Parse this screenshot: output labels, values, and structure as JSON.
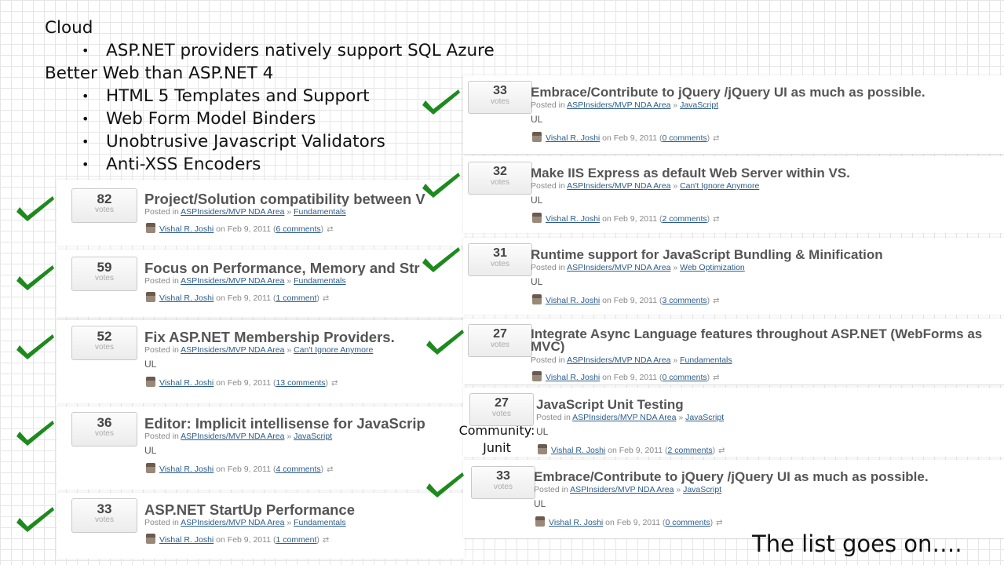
{
  "slide": {
    "heading1": "Cloud",
    "bullets1": [
      "ASP.NET providers natively support SQL Azure"
    ],
    "heading2": "Better Web than ASP.NET 4",
    "bullets2": [
      "HTML 5 Templates and Support",
      "Web Form Model Binders",
      "Unobtrusive Javascript Validators",
      "Anti-XSS Encoders"
    ],
    "community_label": "Community:",
    "community_value": "Junit",
    "footer": "The list goes on…."
  },
  "common": {
    "votes_label": "votes",
    "posted_in": "Posted in",
    "area": "ASPInsiders/MVP NDA Area",
    "sep": "»",
    "author": "Vishal R. Joshi",
    "date": "on Feb 9, 2011",
    "ul": "UL"
  },
  "left_cards": [
    {
      "votes": "82",
      "title": "Project/Solution compatibility between V",
      "category": "Fundamentals",
      "comments": "6 comments",
      "ul": ""
    },
    {
      "votes": "59",
      "title": "Focus on Performance, Memory and Str",
      "category": "Fundamentals",
      "comments": "1 comment",
      "ul": ""
    },
    {
      "votes": "52",
      "title": "Fix ASP.NET Membership Providers.",
      "category": "Can't Ignore Anymore",
      "comments": "13 comments",
      "ul": "UL"
    },
    {
      "votes": "36",
      "title": "Editor: Implicit intellisense for JavaScrip",
      "category": "JavaScript",
      "comments": "4 comments",
      "ul": "UL"
    },
    {
      "votes": "33",
      "title": "ASP.NET StartUp Performance",
      "category": "Fundamentals",
      "comments": "1 comment",
      "ul": ""
    }
  ],
  "right_cards": [
    {
      "votes": "33",
      "title": "Embrace/Contribute to jQuery /jQuery UI as much as possible.",
      "category": "JavaScript",
      "comments": "0 comments",
      "ul": "UL"
    },
    {
      "votes": "32",
      "title": "Make IIS Express as default Web Server within VS.",
      "category": "Can't Ignore Anymore",
      "comments": "2 comments",
      "ul": "UL"
    },
    {
      "votes": "31",
      "title": "Runtime support for JavaScript Bundling & Minification",
      "category": "Web Optimization",
      "comments": "3 comments",
      "ul": "UL"
    },
    {
      "votes": "27",
      "title": "Integrate Async Language features throughout ASP.NET (WebForms as MVC)",
      "category": "Fundamentals",
      "comments": "0 comments",
      "ul": ""
    },
    {
      "votes": "27",
      "title": "JavaScript Unit Testing",
      "category": "JavaScript",
      "comments": "2 comments",
      "ul": "UL"
    },
    {
      "votes": "33",
      "title": "Embrace/Contribute to jQuery /jQuery UI as much as possible.",
      "category": "JavaScript",
      "comments": "0 comments",
      "ul": "UL"
    }
  ],
  "colors": {
    "check": "#1e8a1e",
    "link": "#2b5c8a"
  }
}
